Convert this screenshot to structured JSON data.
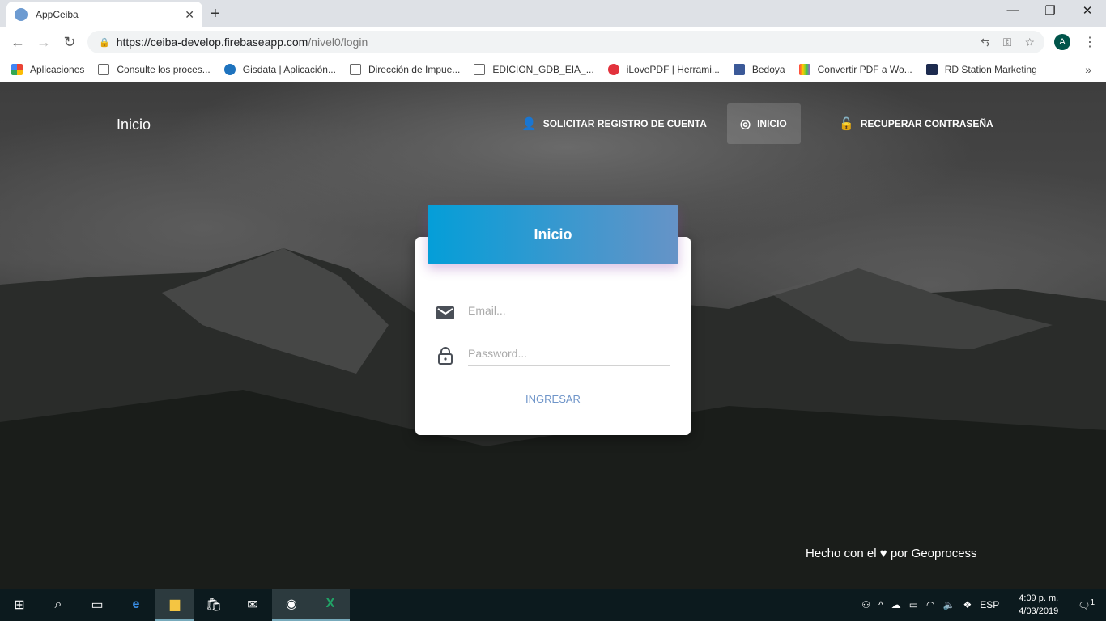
{
  "browser": {
    "tab_title": "AppCeiba",
    "url_host": "https://ceiba-develop.firebaseapp.com",
    "url_path": "/nivel0/login",
    "profile_initial": "A",
    "bookmarks": [
      "Aplicaciones",
      "Consulte los proces...",
      "Gisdata | Aplicación...",
      "Dirección de Impue...",
      "EDICION_GDB_EIA_...",
      "iLovePDF | Herrami...",
      "Bedoya",
      "Convertir PDF a Wo...",
      "RD Station Marketing"
    ]
  },
  "app": {
    "brand": "Inicio",
    "nav": [
      {
        "label": "SOLICITAR REGISTRO DE CUENTA",
        "icon": "person-add-icon"
      },
      {
        "label": "INICIO",
        "icon": "fingerprint-icon",
        "active": true
      },
      {
        "label": "RECUPERAR CONTRASEÑA",
        "icon": "lock-open-icon"
      }
    ],
    "card": {
      "title": "Inicio",
      "email_placeholder": "Email...",
      "password_placeholder": "Password...",
      "submit_label": "INGRESAR"
    },
    "footer": {
      "prefix": "Hecho con el",
      "suffix": "por Geoprocess"
    },
    "colors": {
      "header_start": "#049ed8",
      "header_end": "#6693c7",
      "button": "#6f95c9"
    }
  },
  "taskbar": {
    "lang": "ESP",
    "time": "4:09 p. m.",
    "date": "4/03/2019",
    "notifications": "1"
  }
}
